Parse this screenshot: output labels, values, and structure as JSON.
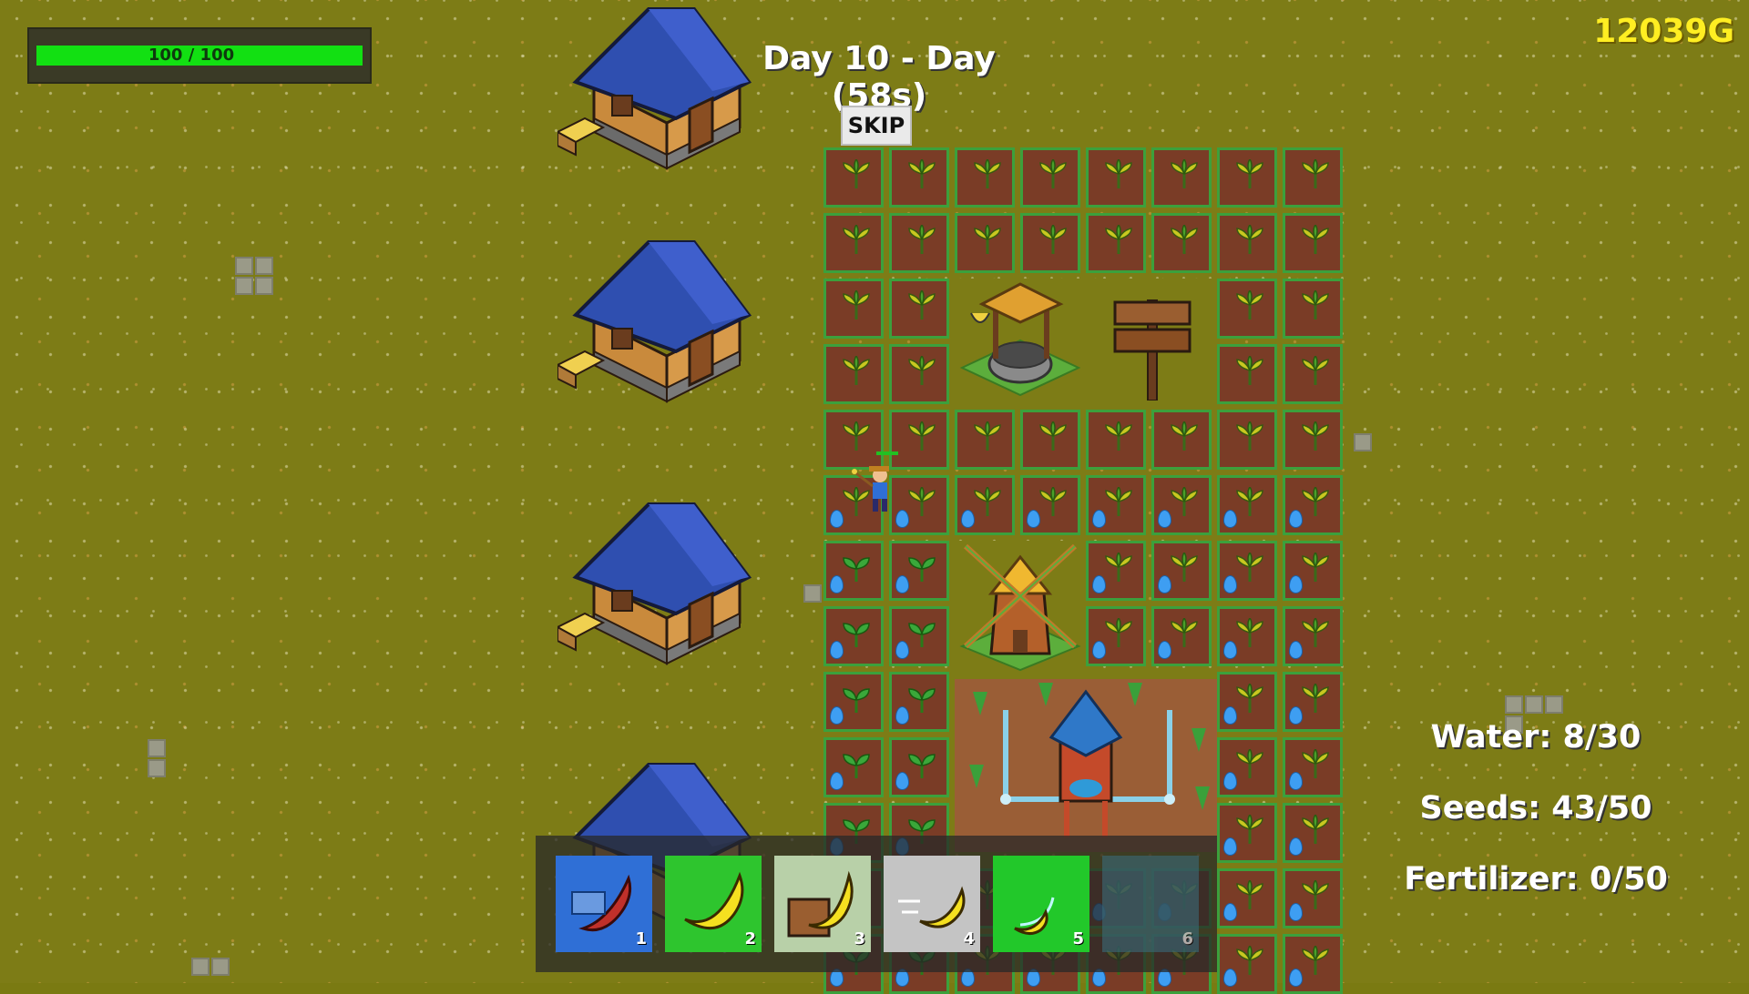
{
  "hud": {
    "health_text": "100 / 100",
    "health_fraction": 1.0,
    "day_title": "Day 10 - Day (58s)",
    "skip_label": "SKIP",
    "gold": "12039G"
  },
  "stats": {
    "water": "Water: 8/30",
    "seeds": "Seeds: 43/50",
    "fertilizer": "Fertilizer: 0/50"
  },
  "hotbar": {
    "slots": [
      {
        "number": "1",
        "icon": "banana-shredder-icon",
        "color": "#2f6fd6"
      },
      {
        "number": "2",
        "icon": "banana-icon",
        "color": "#2ec52e"
      },
      {
        "number": "3",
        "icon": "banana-crate-icon",
        "color": "#b8d0a8"
      },
      {
        "number": "4",
        "icon": "banana-dash-icon",
        "color": "#c4c4c4"
      },
      {
        "number": "5",
        "icon": "banana-boomerang-icon",
        "color": "#22c82a"
      },
      {
        "number": "6",
        "icon": "empty-slot",
        "color": "#3a6a7a"
      }
    ]
  },
  "colors": {
    "grass": "#7d7c16",
    "plot_border": "#3ca03c",
    "soil": "#7a3c26",
    "gold": "#ffee22",
    "health": "#12e012"
  }
}
